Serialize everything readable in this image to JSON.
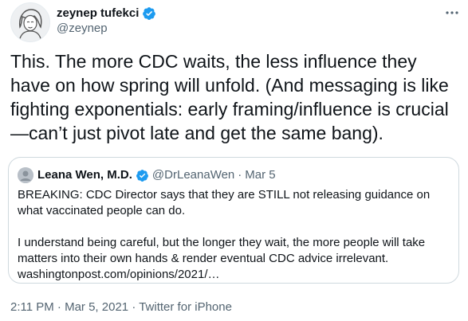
{
  "author": {
    "display_name": "zeynep tufekci",
    "handle": "@zeynep",
    "avatar_icon": "avatar-icon",
    "verified_icon": "verified-badge-icon"
  },
  "tweet": {
    "text": "This. The more CDC waits, the less influence they have on how spring will unfold.  (And messaging is like fighting exponentials: early framing/influence is crucial—can’t just pivot late and get the same bang)."
  },
  "quoted": {
    "display_name": "Leana Wen, M.D.",
    "handle": "@DrLeanaWen",
    "separator": "·",
    "date": "Mar 5",
    "paragraph1": "BREAKING: CDC Director says that they are STILL not releasing guidance on what vaccinated people can do.",
    "paragraph2": "I understand being careful, but the longer they wait, the more people will take matters into their own hands & render eventual CDC advice irrelevant.",
    "link": "washingtonpost.com/opinions/2021/…"
  },
  "meta": {
    "time": "2:11 PM",
    "separator": "·",
    "date": "Mar 5, 2021",
    "source": "Twitter for iPhone"
  },
  "colors": {
    "accent": "#1d9bf0",
    "text": "#0f1419",
    "secondary": "#536471",
    "border": "#cfd9de"
  }
}
